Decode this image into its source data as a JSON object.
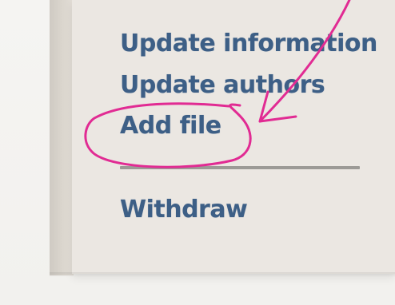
{
  "menu": {
    "items": [
      {
        "label": "Update information"
      },
      {
        "label": "Update authors"
      },
      {
        "label": "Add file"
      }
    ],
    "secondary_items": [
      {
        "label": "Withdraw"
      }
    ]
  },
  "colors": {
    "link": "#3d5f86",
    "panel": "#ebe7e2",
    "annotation": "#e12b93"
  },
  "annotation": {
    "shapes": [
      "circle-highlight",
      "pointing-arrow"
    ]
  }
}
